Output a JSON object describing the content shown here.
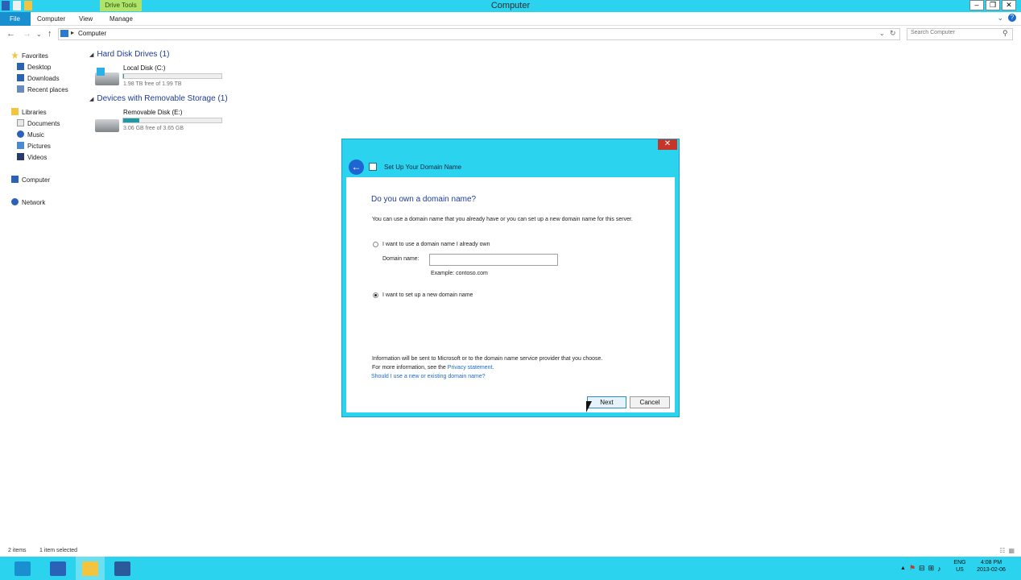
{
  "window": {
    "title": "Computer",
    "context_tab": "Drive Tools",
    "controls": {
      "minimize": "–",
      "restore": "❐",
      "close": "✕"
    }
  },
  "ribbon": {
    "tabs": [
      {
        "label": "File"
      },
      {
        "label": "Computer"
      },
      {
        "label": "View"
      },
      {
        "label": "Manage"
      }
    ],
    "expand_glyph": "⌄",
    "help_glyph": "?"
  },
  "address": {
    "back": "←",
    "forward": "→",
    "recent": "⌄",
    "up": "↑",
    "separator": "▸",
    "path": "Computer",
    "dropdown": "⌄",
    "refresh": "↻",
    "search_placeholder": "Search Computer",
    "search_glyph": "⚲"
  },
  "nav": {
    "favorites": {
      "label": "Favorites",
      "items": [
        {
          "label": "Desktop"
        },
        {
          "label": "Downloads"
        },
        {
          "label": "Recent places"
        }
      ]
    },
    "libraries": {
      "label": "Libraries",
      "items": [
        {
          "label": "Documents"
        },
        {
          "label": "Music"
        },
        {
          "label": "Pictures"
        },
        {
          "label": "Videos"
        }
      ]
    },
    "computer": "Computer",
    "network": "Network"
  },
  "content": {
    "groups": [
      {
        "title": "Hard Disk Drives (1)",
        "drives": [
          {
            "name": "Local Disk (C:)",
            "free": "1.98 TB free of 1.99 TB",
            "used_fraction": 0.005
          }
        ]
      },
      {
        "title": "Devices with Removable Storage (1)",
        "drives": [
          {
            "name": "Removable Disk (E:)",
            "free": "3.06 GB free of 3.65 GB",
            "used_fraction": 0.16
          }
        ]
      }
    ],
    "group_toggle": "◢"
  },
  "dialog": {
    "title": "Set Up Your Domain Name",
    "back_glyph": "←",
    "close_glyph": "✕",
    "heading": "Do you own a domain name?",
    "intro": "You can use a domain name that you already have or you can set up a new domain name for this server.",
    "option_existing": "I want to use a domain name I already own",
    "domain_label": "Domain name:",
    "domain_value": "",
    "example": "Example: contoso.com",
    "option_new": "I want to set up a new domain name",
    "info_line1": "Information will be sent to Microsoft or to the domain name service provider that you choose.",
    "info_line2": "For more information, see the",
    "privacy_link": "Privacy statement",
    "info_end": ".",
    "help_link": "Should I use a new or existing domain name?",
    "next": "Next",
    "cancel": "Cancel",
    "selected_option": "new"
  },
  "status": {
    "items": "2 items",
    "selected": "1 item selected"
  },
  "taskbar": {
    "tray_glyphs": [
      "▲",
      "⚑",
      "⊟",
      "⊞",
      "♪"
    ],
    "lang1": "ENG",
    "lang2": "US",
    "time": "4:08 PM",
    "date": "2013-02-06"
  },
  "colors": {
    "accent": "#2bd3ee",
    "file_tab": "#1a8fd0",
    "close_red": "#c7352a",
    "link": "#1a6ad0",
    "heading": "#1e3c96"
  }
}
